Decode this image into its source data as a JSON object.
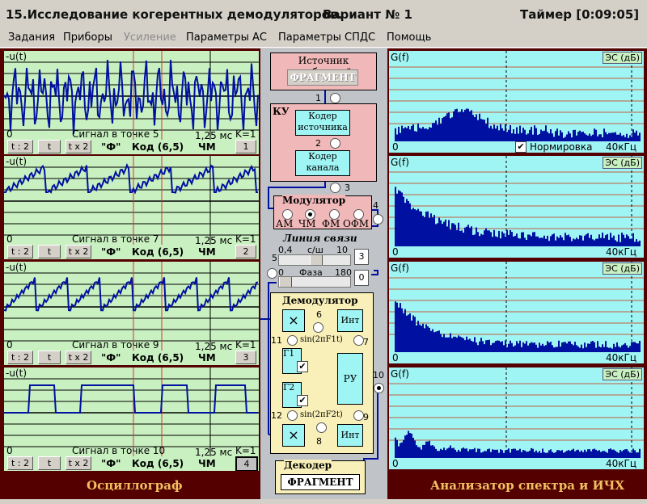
{
  "title": {
    "main": "15.Исследование когерентных демодуляторов.",
    "variant": "Вариант № 1",
    "timer": "Таймер [0:09:05]"
  },
  "menu": [
    "Задания",
    "Приборы",
    "Усиление",
    "Параметры АС",
    "Параметры СПДС",
    "Помощь"
  ],
  "osc": {
    "ylabel": "-u(t)",
    "zero": "0",
    "time": "1,25 мс",
    "k": "K=1",
    "btn_t2": "t : 2",
    "btn_t": "t",
    "btn_tx2": "t x 2",
    "f": "\"Ф\"",
    "code": "Код (6,5)",
    "mod": "ЧМ",
    "panels": [
      {
        "signal": "Сигнал в точке 5",
        "num": "1"
      },
      {
        "signal": "Сигнал в точке 7",
        "num": "2"
      },
      {
        "signal": "Сигнал в точке 9",
        "num": "3"
      },
      {
        "signal": "Сигнал в точке 10",
        "num": "4"
      }
    ]
  },
  "spec": {
    "ylabel": "G(f)",
    "zero": "0",
    "freq": "40кГц",
    "es": "ЭС (дБ)",
    "norm": "Нормировка"
  },
  "center": {
    "source_title": "Источник сообщений",
    "source_btn": "ФРАГМЕНТ",
    "ku": "КУ",
    "coder_src": "Кодер источника",
    "coder_ch": "Кодер канала",
    "modulator": "Модулятор",
    "mods": [
      "АМ",
      "ЧМ",
      "ФМ",
      "ОФМ"
    ],
    "line": "Линия связи",
    "snr": {
      "min": "0,4",
      "label": "с/ш",
      "max": "10",
      "value": "3"
    },
    "phase": {
      "min": "0",
      "label": "Фаза",
      "max": "180",
      "value": "0"
    },
    "demod": "Демодулятор",
    "int": "Инт",
    "ru": "РУ",
    "g1": "Г1",
    "g2": "Г2",
    "sin1": "sin(2πF1t)",
    "sin2": "sin(2πF2t)",
    "decoder": "Декодер",
    "decoder_btn": "ФРАГМЕНТ",
    "points": [
      "1",
      "2",
      "3",
      "4",
      "5",
      "6",
      "7",
      "8",
      "9",
      "10",
      "11",
      "12"
    ]
  },
  "footer": {
    "left": "Осциллограф",
    "right": "Анализатор спектра и ИЧХ"
  },
  "colors": {
    "osc_bg": "#c8f0c0",
    "spec_bg": "#9ff4f4",
    "frame": "#550000",
    "signal": "#0010a0",
    "marker": "#e03030"
  }
}
